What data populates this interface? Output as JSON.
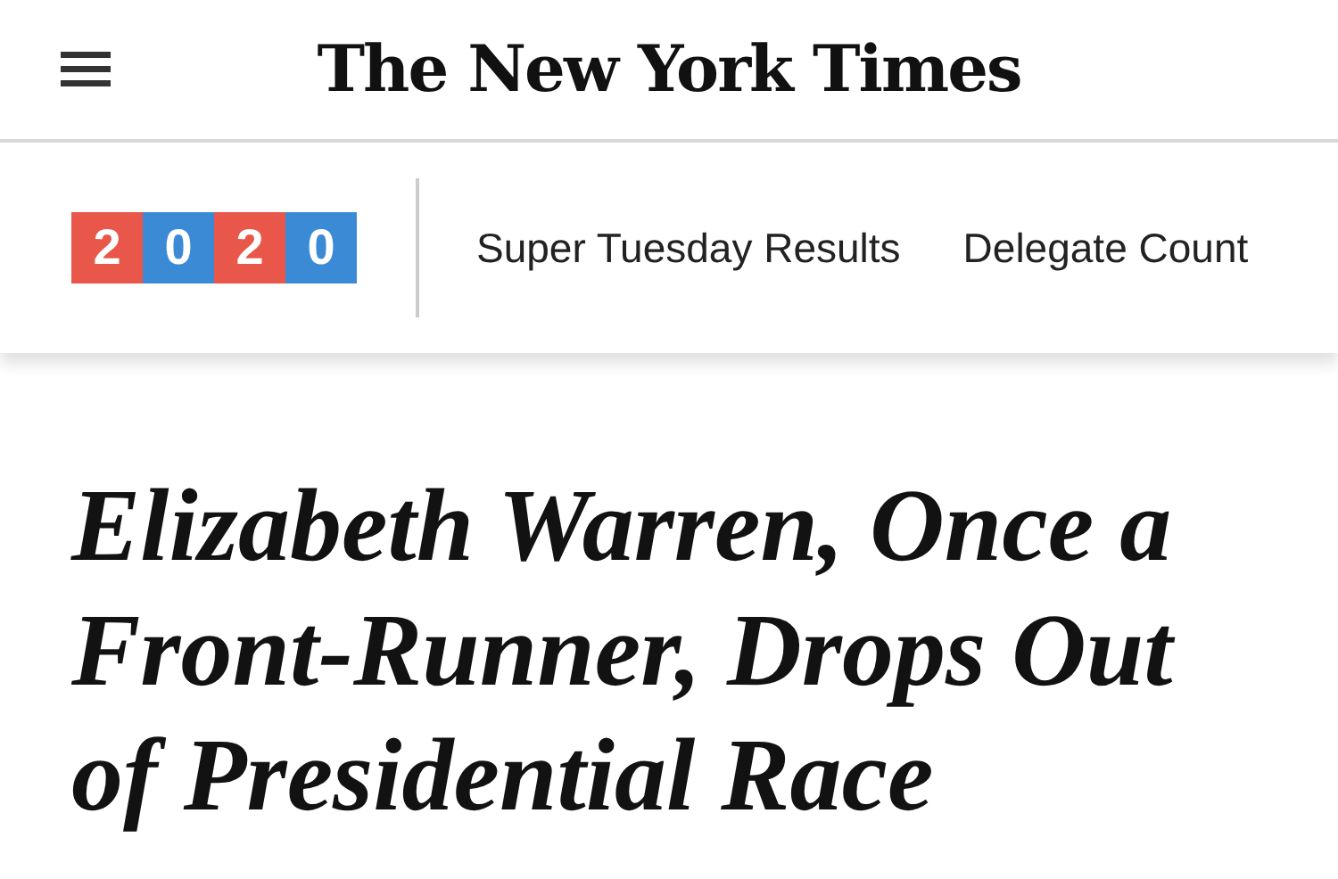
{
  "masthead": {
    "logo": "The New York Times"
  },
  "election_badge": {
    "digits": [
      {
        "text": "2",
        "color": "#e9564a"
      },
      {
        "text": "0",
        "color": "#3b8ad6"
      },
      {
        "text": "2",
        "color": "#e9564a"
      },
      {
        "text": "0",
        "color": "#3b8ad6"
      }
    ]
  },
  "nav_links": [
    "Super Tuesday Results",
    "Delegate Count"
  ],
  "headline": "Elizabeth Warren, Once a Front-Runner, Drops Out of Presidential Race"
}
